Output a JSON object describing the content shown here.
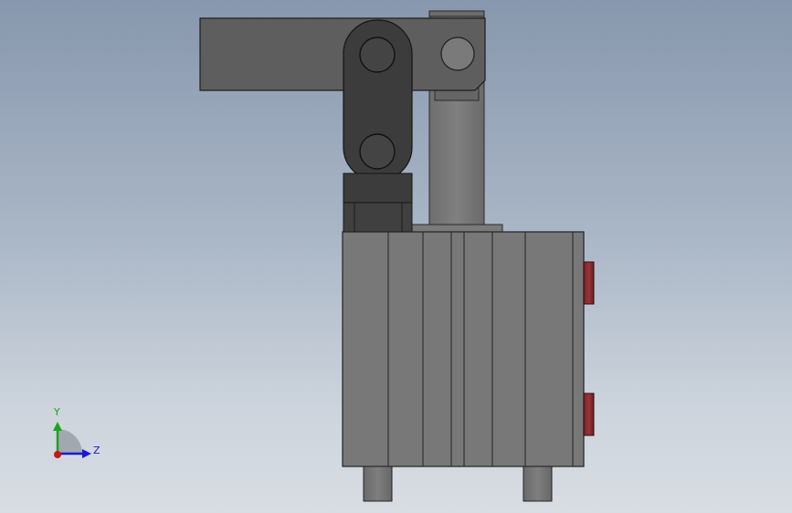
{
  "viewport": {
    "name": "cad-3d-viewport"
  },
  "triad": {
    "y_label": "Y",
    "z_label": "Z",
    "y_color": "#1aa51a",
    "z_color": "#1a1ad0",
    "x_color": "#c81818"
  },
  "colors": {
    "body_gray": "#787878",
    "dark_link": "#3c3c3c",
    "arm_gray": "#5e5e5e",
    "port_red": "#8c2a2e"
  }
}
